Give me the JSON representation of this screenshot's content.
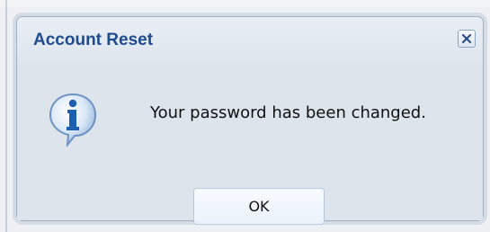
{
  "dialog": {
    "title": "Account Reset",
    "message": "Your password has been changed.",
    "ok_label": "OK",
    "close_icon": "close-icon",
    "info_icon": "info-icon"
  },
  "colors": {
    "title": "#1f4b8f",
    "dialog_bg": "#dde4ec",
    "border": "#9fb0c4",
    "icon_blue": "#1b5fb0"
  }
}
